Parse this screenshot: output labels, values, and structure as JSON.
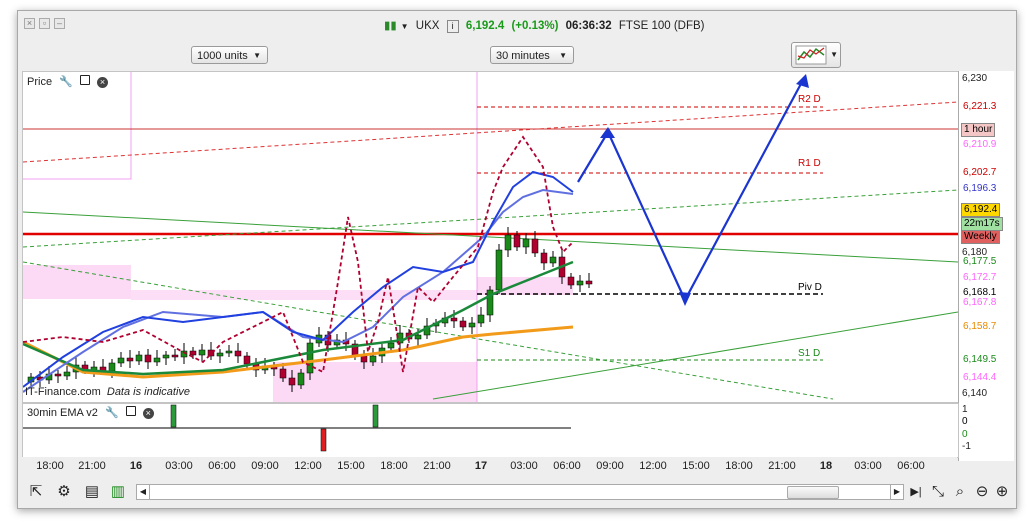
{
  "window": {
    "instrument": "UKX",
    "price": "6,192.4",
    "change": "(+0.13%)",
    "time": "06:36:32",
    "market": "FTSE 100 (DFB)"
  },
  "toolbar": {
    "units": "1000 units",
    "interval": "30 minutes"
  },
  "price_pane": {
    "label": "Price"
  },
  "indicator_pane": {
    "label": "30min EMA v2"
  },
  "watermark": "IT-Finance.com",
  "indicative": "Data is indicative",
  "levels": {
    "r2": "R2 D",
    "r1": "R1 D",
    "piv": "Piv D",
    "s1": "S1 D"
  },
  "price_axis": {
    "ticks": [
      "6,230",
      "6,180",
      "6,140"
    ],
    "tags": [
      {
        "text": "6,221.3",
        "color": "#cc0000",
        "bg": "#ffffff"
      },
      {
        "text": "1 hour",
        "color": "#000000",
        "bg": "#f4c6c6"
      },
      {
        "text": "6,210.9",
        "color": "#ff66ff",
        "bg": "#ffffff"
      },
      {
        "text": "6,202.7",
        "color": "#cc0000",
        "bg": "#ffffff"
      },
      {
        "text": "6,196.3",
        "color": "#3333cc",
        "bg": "#ffffff"
      },
      {
        "text": "6,192.4",
        "color": "#000000",
        "bg": "#ffd800"
      },
      {
        "text": "22m17s",
        "color": "#000000",
        "bg": "#a0e0a0"
      },
      {
        "text": "Weekly",
        "color": "#000000",
        "bg": "#e06060"
      },
      {
        "text": "6,177.5",
        "color": "#1a8a1a",
        "bg": "#ffffff"
      },
      {
        "text": "6,172.7",
        "color": "#ff66ff",
        "bg": "#ffffff"
      },
      {
        "text": "6,168.1",
        "color": "#000000",
        "bg": "#ffffff"
      },
      {
        "text": "6,167.8",
        "color": "#ff66ff",
        "bg": "#ffffff"
      },
      {
        "text": "6,158.7",
        "color": "#e88a00",
        "bg": "#ffffff"
      },
      {
        "text": "6,149.5",
        "color": "#1a8a1a",
        "bg": "#ffffff"
      },
      {
        "text": "6,144.4",
        "color": "#ff66ff",
        "bg": "#ffffff"
      }
    ]
  },
  "indicator_axis": [
    "1",
    "0",
    "0",
    "-1"
  ],
  "time_axis": [
    "18:00",
    "21:00",
    "16",
    "03:00",
    "06:00",
    "09:00",
    "12:00",
    "15:00",
    "18:00",
    "21:00",
    "17",
    "03:00",
    "06:00",
    "09:00",
    "12:00",
    "15:00",
    "18:00",
    "21:00",
    "18",
    "03:00",
    "06:00"
  ],
  "colors": {
    "up": "#1a8a1a",
    "down": "#b00030",
    "projection": "#1a35d0",
    "ema_blue": "#2040e0",
    "ema_orange": "#f29b1a",
    "weekly": "#e00000"
  }
}
